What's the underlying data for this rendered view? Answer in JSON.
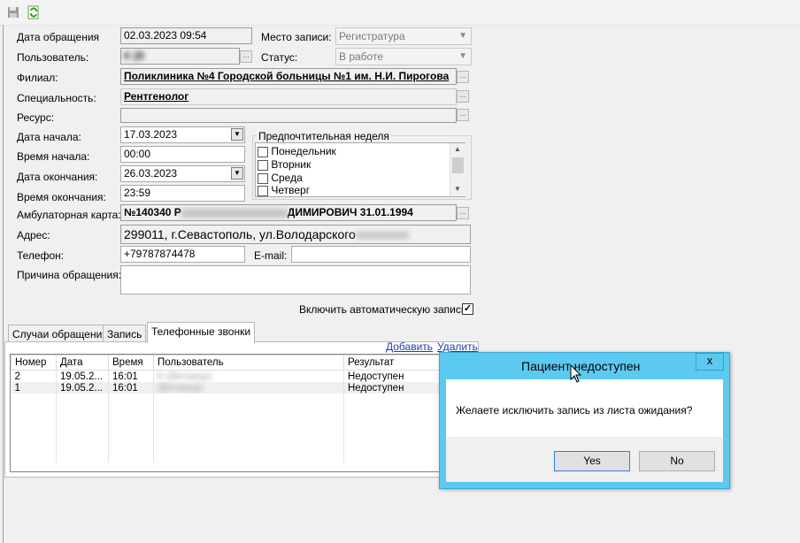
{
  "toolbar": {
    "icons": [
      "save-icon",
      "refresh-icon"
    ]
  },
  "form": {
    "date_label": "Дата обращения",
    "date_value": "02.03.2023 09:54",
    "place_label": "Место записи:",
    "place_value": "Регистратура",
    "user_label": "Пользователь:",
    "user_value": "К                  (В",
    "status_label": "Статус:",
    "status_value": "В работе",
    "branch_label": "Филиал:",
    "branch_value": "Поликлиника №4 Городской больницы №1 им. Н.И. Пирогова",
    "specialty_label": "Специальность:",
    "specialty_value": "Рентгенолог",
    "resource_label": "Ресурс:",
    "resource_value": "",
    "start_date_label": "Дата начала:",
    "start_date_value": "17.03.2023",
    "start_time_label": "Время начала:",
    "start_time_value": "00:00",
    "end_date_label": "Дата окончания:",
    "end_date_value": "26.03.2023",
    "end_time_label": "Время окончания:",
    "end_time_value": "23:59",
    "preferred_week_label": "Предпочтительная неделя",
    "weekdays": [
      "Понедельник",
      "Вторник",
      "Среда",
      "Четверг"
    ],
    "card_label": "Амбулаторная карта:",
    "card_value_prefix": "№140340 Р",
    "card_value_suffix": "ДИМИРОВИЧ 31.01.1994",
    "address_label": "Адрес:",
    "address_value": "299011, г.Севастополь, ул.Володарского",
    "phone_label": "Телефон:",
    "phone_value": "+79787874478",
    "email_label": "E-mail:",
    "email_value": "",
    "reason_label": "Причина обращения:",
    "reason_value": "",
    "auto_record_label": "Включить автоматическую запись",
    "auto_record_checked": true
  },
  "tabs": [
    "Случаи обращения",
    "Запись",
    "Телефонные звонки"
  ],
  "grid_actions": {
    "add": "Добавить",
    "delete": "Удалить"
  },
  "grid": {
    "columns": [
      "Номер",
      "Дата",
      "Время",
      "Пользователь",
      "Результат"
    ],
    "rows": [
      {
        "num": "2",
        "date": "19.05.2...",
        "time": "16:01",
        "user": "К              (Витакор)",
        "result": "Недоступен"
      },
      {
        "num": "1",
        "date": "19.05.2...",
        "time": "16:01",
        "user": "               (Витакор)",
        "result": "Недоступен"
      }
    ]
  },
  "dialog": {
    "title": "Пациент недоступен",
    "message": "Желаете исключить запись из листа ожидания?",
    "yes": "Yes",
    "no": "No",
    "close": "x"
  }
}
